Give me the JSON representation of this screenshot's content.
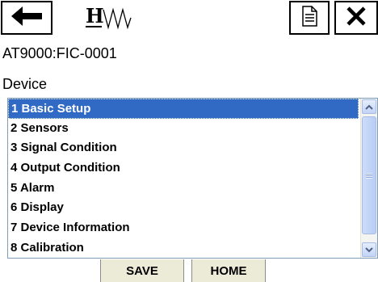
{
  "toolbar": {
    "back_icon": "arrow-left-icon",
    "logo_icon": "hart-logo-icon",
    "logo_text": "H",
    "document_icon": "document-icon",
    "close_icon": "close-icon"
  },
  "device_id": "AT9000:FIC-0001",
  "section_title": "Device",
  "menu": {
    "items": [
      "1 Basic Setup",
      "2 Sensors",
      "3 Signal Condition",
      "4 Output Condition",
      "5 Alarm",
      "6 Display",
      "7 Device Information",
      "8 Calibration"
    ],
    "selected_index": 0
  },
  "buttons": {
    "save": "SAVE",
    "home": "HOME"
  },
  "colors": {
    "selection": "#316ac5",
    "button_bg": "#ecebd8",
    "scrollbar": "#c3d3f7"
  }
}
